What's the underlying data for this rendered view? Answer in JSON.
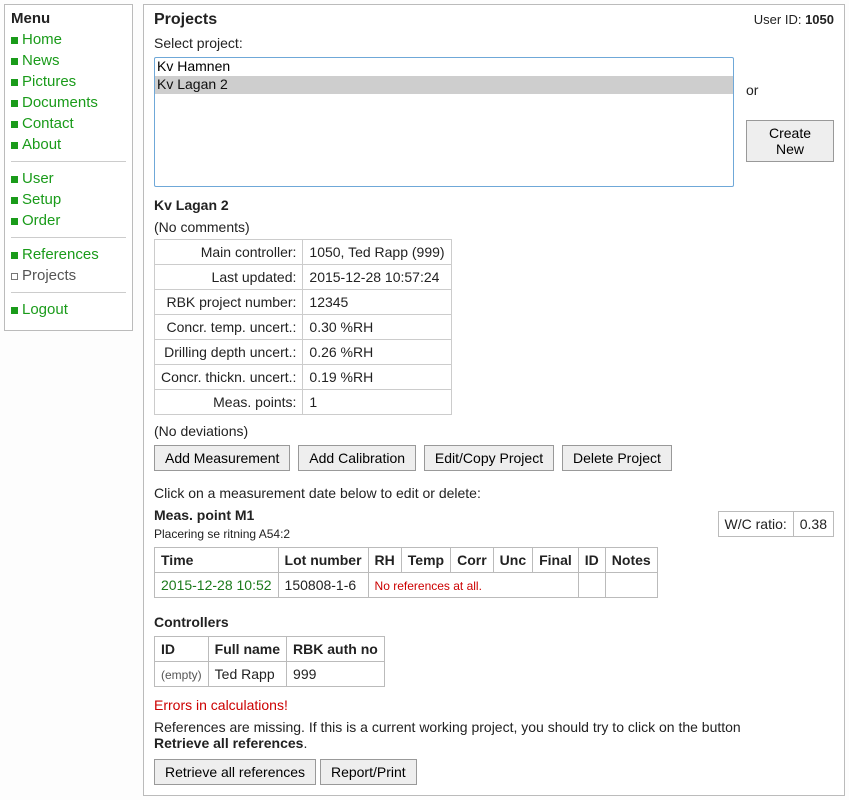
{
  "menu": {
    "title": "Menu",
    "items_a": [
      {
        "label": "Home"
      },
      {
        "label": "News"
      },
      {
        "label": "Pictures"
      },
      {
        "label": "Documents"
      },
      {
        "label": "Contact"
      },
      {
        "label": "About"
      }
    ],
    "items_b": [
      {
        "label": "User"
      },
      {
        "label": "Setup"
      },
      {
        "label": "Order"
      }
    ],
    "items_c": [
      {
        "label": "References"
      },
      {
        "label": "Projects",
        "current": true
      }
    ],
    "items_d": [
      {
        "label": "Logout"
      }
    ]
  },
  "header": {
    "title": "Projects",
    "user_id_label": "User ID:",
    "user_id": "1050"
  },
  "select": {
    "label": "Select project:",
    "options": [
      "Kv Hamnen",
      "Kv Lagan 2"
    ],
    "selected": "Kv Lagan 2",
    "or": "or",
    "create_new": "Create New"
  },
  "project": {
    "name": "Kv Lagan 2",
    "no_comments": "(No comments)",
    "info": [
      {
        "label": "Main controller:",
        "value": "1050, Ted Rapp (999)"
      },
      {
        "label": "Last updated:",
        "value": "2015-12-28 10:57:24"
      },
      {
        "label": "RBK project number:",
        "value": "12345"
      },
      {
        "label": "Concr. temp. uncert.:",
        "value": "0.30 %RH"
      },
      {
        "label": "Drilling depth uncert.:",
        "value": "0.26 %RH"
      },
      {
        "label": "Concr. thickn. uncert.:",
        "value": "0.19 %RH"
      },
      {
        "label": "Meas. points:",
        "value": "1"
      }
    ],
    "no_deviations": "(No deviations)"
  },
  "buttons": {
    "add_meas": "Add Measurement",
    "add_cal": "Add Calibration",
    "edit_copy": "Edit/Copy Project",
    "delete": "Delete Project",
    "retrieve": "Retrieve all references",
    "report": "Report/Print"
  },
  "instruction": "Click on a measurement date below to edit or delete:",
  "mp": {
    "name": "Meas. point M1",
    "desc": "Placering se ritning A54:2",
    "wc_label": "W/C ratio:",
    "wc_value": "0.38"
  },
  "meas_table": {
    "headers": [
      "Time",
      "Lot number",
      "RH",
      "Temp",
      "Corr",
      "Unc",
      "Final",
      "ID",
      "Notes"
    ],
    "row": {
      "time": "2015-12-28 10:52",
      "lot": "150808-1-6",
      "noref": "No references at all."
    }
  },
  "controllers": {
    "title": "Controllers",
    "headers": [
      "ID",
      "Full name",
      "RBK auth no"
    ],
    "row": {
      "id": "(empty)",
      "name": "Ted Rapp",
      "auth": "999"
    }
  },
  "errors": {
    "title": "Errors in calculations!",
    "msg1": "References are missing. If this is a current working project, you should try to click on the button",
    "msg2": "Retrieve all references",
    "msg3": "."
  }
}
